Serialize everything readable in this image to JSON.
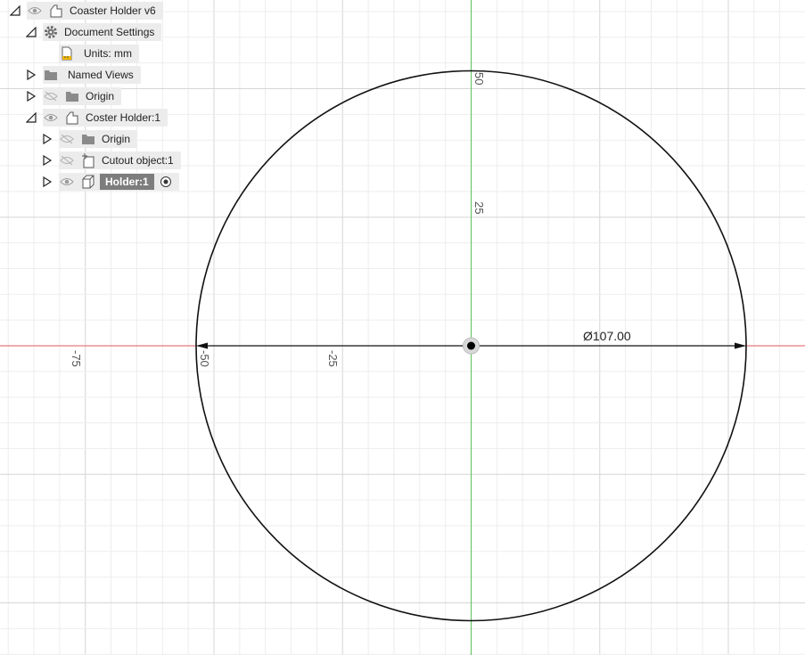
{
  "browser": {
    "root": {
      "label": "Coaster Holder v6"
    },
    "document_settings": {
      "label": "Document Settings"
    },
    "units": {
      "label": "Units: mm"
    },
    "named_views": {
      "label": "Named Views"
    },
    "origin": {
      "label": "Origin"
    },
    "component": {
      "label": "Coster Holder:1"
    },
    "comp_origin": {
      "label": "Origin"
    },
    "cutout": {
      "label": "Cutout object:1"
    },
    "holder": {
      "label": "Holder:1"
    }
  },
  "sketch": {
    "axis_ticks": {
      "x": [
        "-75",
        "-50",
        "-25"
      ],
      "y": [
        "50",
        "25"
      ]
    },
    "dimension": "Ø107.00",
    "circle_diameter_mm": 107.0,
    "colors": {
      "x_axis": "#e35a5a",
      "y_axis": "#5cc25c",
      "grid_minor": "#ededed",
      "grid_major": "#d6d6d6",
      "curve": "#111111"
    }
  }
}
